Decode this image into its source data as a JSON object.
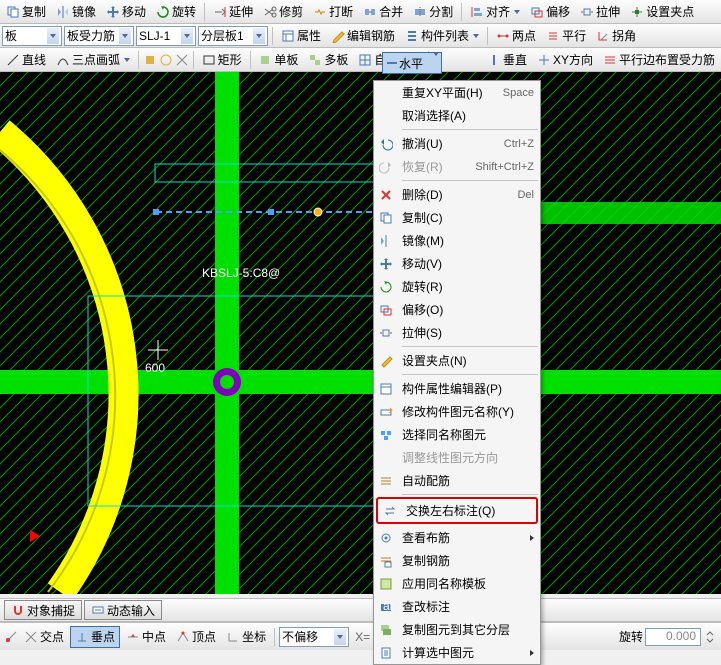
{
  "tb1": {
    "copy": "复制",
    "mirror": "镜像",
    "move": "移动",
    "rotate": "旋转",
    "extend": "延伸",
    "trim": "修剪",
    "break": "打断",
    "merge": "合并",
    "split": "分割",
    "align": "对齐",
    "offset": "偏移",
    "stretch": "拉伸",
    "setclip": "设置夹点"
  },
  "tb2": {
    "slab": "板",
    "slabbar": "板受力筋",
    "slj": "SLJ-1",
    "layer": "分层板1",
    "attr": "属性",
    "editbar": "编辑钢筋",
    "memlist": "构件列表",
    "twopt": "两点",
    "parallel": "平行",
    "corner": "拐角"
  },
  "tb3": {
    "line": "直线",
    "arc3": "三点画弧",
    "rect": "矩形",
    "single": "单板",
    "multi": "多板",
    "custom": "自定义",
    "horiz": "水平",
    "vert": "垂直",
    "xy": "XY方向",
    "edge": "平行边布置受力筋"
  },
  "overlay": {
    "horiz": "水平"
  },
  "ctx": {
    "repeatXY": "重复XY平面(H)",
    "space": "Space",
    "cancel": "取消选择(A)",
    "undo": "撤消(U)",
    "ctrlz": "Ctrl+Z",
    "redo": "恢复(R)",
    "shctrlz": "Shift+Ctrl+Z",
    "del": "删除(D)",
    "delkey": "Del",
    "copy": "复制(C)",
    "mirror": "镜像(M)",
    "move": "移动(V)",
    "rotate": "旋转(R)",
    "offset": "偏移(O)",
    "stretch": "拉伸(S)",
    "clip": "设置夹点(N)",
    "propedit": "构件属性编辑器(P)",
    "rename": "修改构件图元名称(Y)",
    "selname": "选择同名称图元",
    "linedir": "调整线性图元方向",
    "autobar": "自动配筋",
    "swap": "交换左右标注(Q)",
    "viewbar": "查看布筋",
    "copybar": "复制钢筋",
    "applytpl": "应用同名称模板",
    "viewann": "查改标注",
    "copylayer": "复制图元到其它分层",
    "calcsel": "计算选中图元"
  },
  "bottom": {
    "snap": "对象捕捉",
    "dyninput": "动态输入"
  },
  "sb": {
    "intersect": "交点",
    "perp": "垂点",
    "mid": "中点",
    "apex": "顶点",
    "coord": "坐标",
    "nooffset": "不偏移",
    "x": "X=",
    "rotate": "旋转",
    "zero": "0.000"
  },
  "canvas": {
    "label": "KBSLJ-5:C8@",
    "dim": "600"
  }
}
